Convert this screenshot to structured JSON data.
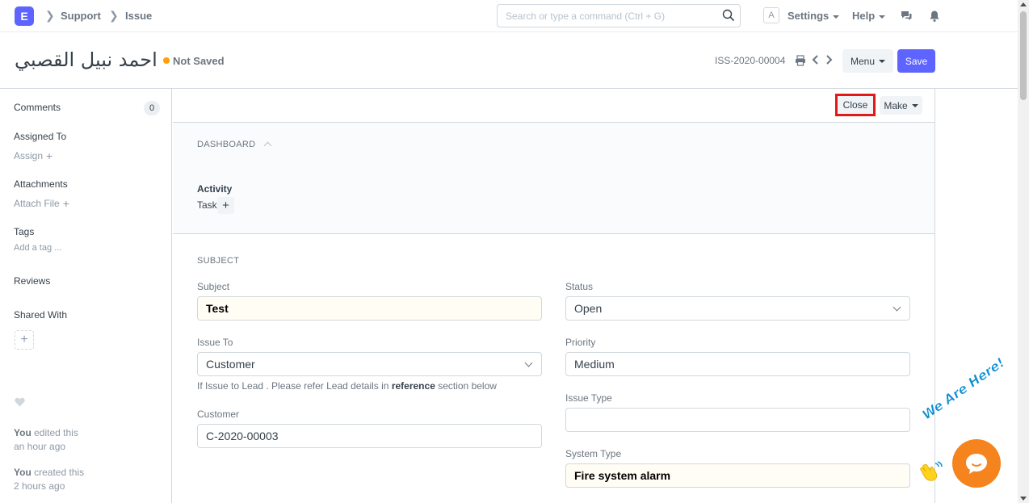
{
  "navbar": {
    "logo_letter": "E",
    "breadcrumbs": [
      "Support",
      "Issue"
    ],
    "search_placeholder": "Search or type a command (Ctrl + G)",
    "avatar_letter": "A",
    "settings_label": "Settings",
    "help_label": "Help"
  },
  "page_head": {
    "title": "احمد نبيل القصبي",
    "status": "Not Saved",
    "status_color": "#ffa00a",
    "doc_id": "ISS-2020-00004",
    "menu_label": "Menu",
    "save_label": "Save",
    "primary_color": "#5e64ff"
  },
  "sidebar": {
    "comments_label": "Comments",
    "comments_count": "0",
    "assigned_to_label": "Assigned To",
    "assign_label": "Assign",
    "attachments_label": "Attachments",
    "attach_file_label": "Attach File",
    "tags_label": "Tags",
    "add_tag_label": "Add a tag ...",
    "reviews_label": "Reviews",
    "shared_with_label": "Shared With",
    "timeline": [
      {
        "actor": "You",
        "action": " edited this",
        "time": "an hour ago"
      },
      {
        "actor": "You",
        "action": " created this",
        "time": "2 hours ago"
      }
    ]
  },
  "form_toolbar": {
    "close_label": "Close",
    "make_label": "Make"
  },
  "dashboard": {
    "title": "DASHBOARD",
    "activity_label": "Activity",
    "task_label": "Task"
  },
  "subject_section": {
    "title": "SUBJECT",
    "subject_label": "Subject",
    "subject_value": "Test",
    "issue_to_label": "Issue To",
    "issue_to_value": "Customer",
    "help_prefix": "If Issue to Lead . Please refer Lead details in ",
    "help_bold": "reference",
    "help_suffix": " section below",
    "customer_label": "Customer",
    "customer_value": "C-2020-00003",
    "status_label": "Status",
    "status_value": "Open",
    "priority_label": "Priority",
    "priority_value": "Medium",
    "issue_type_label": "Issue Type",
    "issue_type_value": "",
    "system_type_label": "System Type",
    "system_type_value": "Fire system alarm"
  },
  "chat_widget": {
    "tagline": "We Are Here!",
    "color": "#f5841f"
  }
}
